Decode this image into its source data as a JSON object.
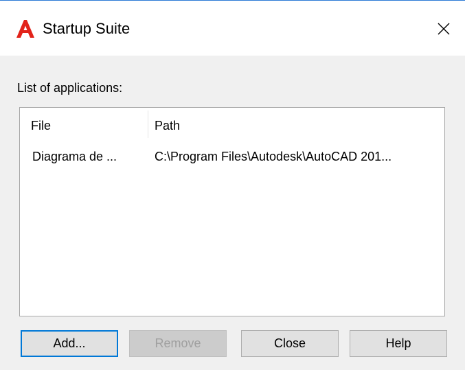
{
  "window": {
    "title": "Startup Suite",
    "icon": "autocad-logo-icon",
    "accent": "#0078d7",
    "icon_color": "#e2231a"
  },
  "list": {
    "label": "List of applications:",
    "columns": [
      "File",
      "Path"
    ],
    "rows": [
      {
        "file": "Diagrama de ...",
        "path": "C:\\Program Files\\Autodesk\\AutoCAD 201..."
      }
    ]
  },
  "buttons": {
    "add": "Add...",
    "remove": "Remove",
    "close": "Close",
    "help": "Help"
  }
}
